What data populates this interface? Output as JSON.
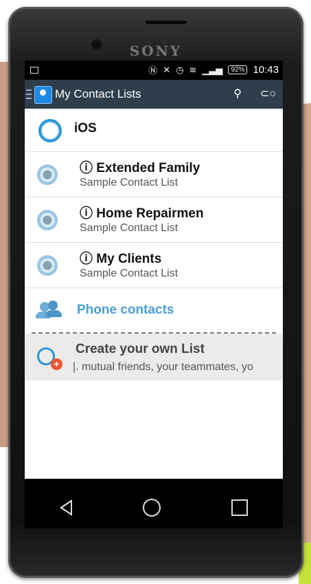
{
  "device": {
    "brand": "SONY"
  },
  "status_bar": {
    "battery": "92%",
    "time": "10:43",
    "icons": [
      "image-icon",
      "nfc-icon",
      "mute-icon",
      "alarm-icon",
      "wifi-icon",
      "signal-icon"
    ]
  },
  "app_bar": {
    "title": "My Contact Lists",
    "search_icon": "search-icon",
    "add_list_icon": "add-list-icon"
  },
  "lists": {
    "ios": {
      "label": "iOS"
    },
    "items": [
      {
        "title": "ⓘ Extended Family",
        "subtitle": "Sample Contact List"
      },
      {
        "title": "ⓘ Home Repairmen",
        "subtitle": "Sample Contact List"
      },
      {
        "title": "ⓘ My Clients",
        "subtitle": "Sample Contact List"
      }
    ],
    "phone_contacts": {
      "label": "Phone contacts"
    },
    "create": {
      "title": "Create your own List",
      "subtitle": "|. mutual friends, your teammates, yo"
    }
  },
  "colors": {
    "app_bar": "#2f3e4c",
    "accent_blue": "#2a95d8",
    "phone_contacts_text": "#4a9fd6",
    "create_plus": "#f0542d"
  }
}
